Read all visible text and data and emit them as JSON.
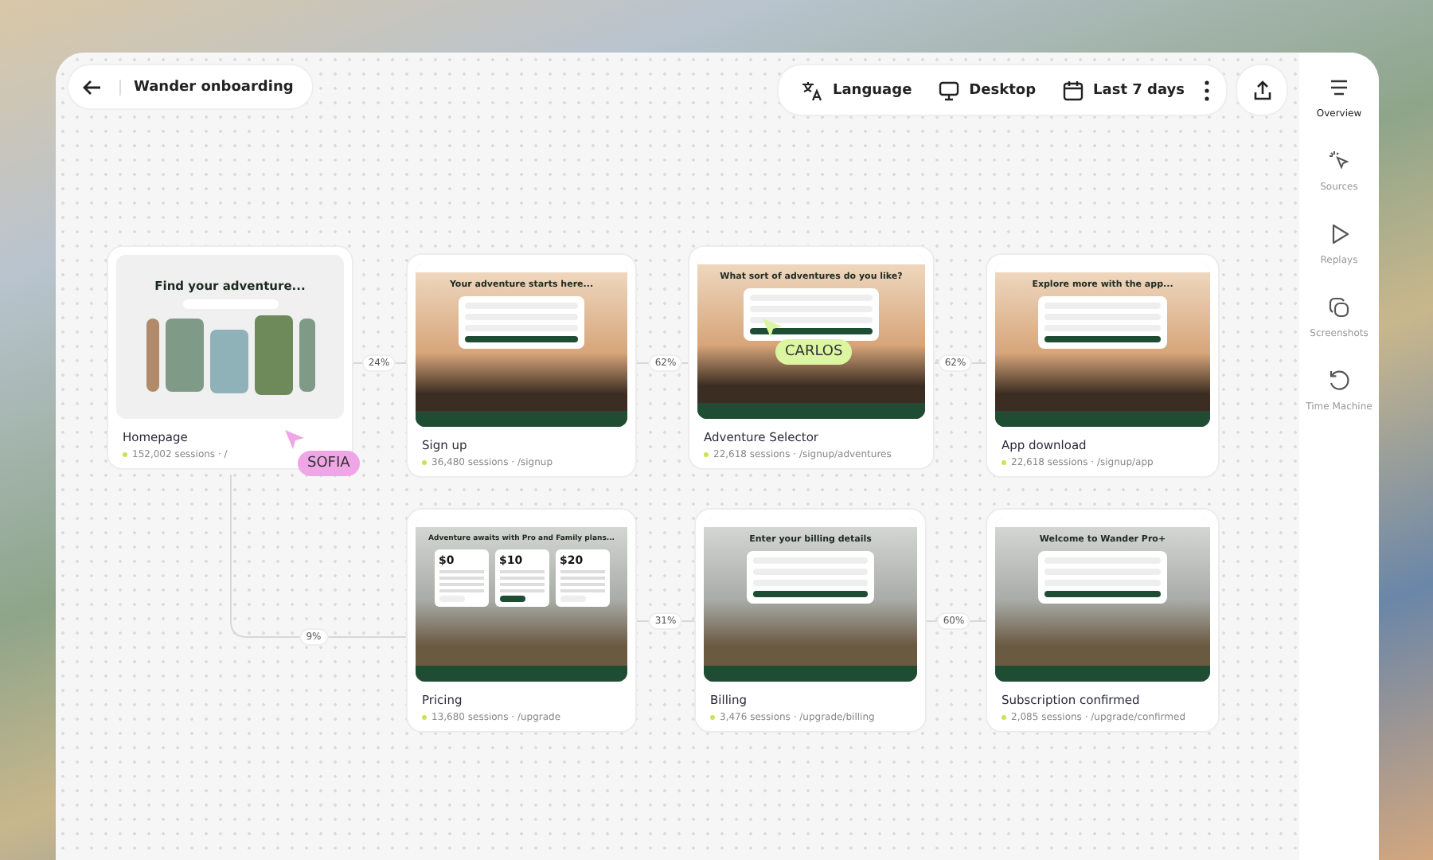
{
  "toolbar": {
    "title": "Wander onboarding",
    "filters": [
      {
        "kind": "language",
        "label": "Language"
      },
      {
        "kind": "device",
        "label": "Desktop"
      },
      {
        "kind": "date",
        "label": "Last 7 days"
      }
    ]
  },
  "sidebar": {
    "items": [
      {
        "kind": "overview",
        "label": "Overview",
        "selected": true
      },
      {
        "kind": "sources",
        "label": "Sources",
        "selected": false
      },
      {
        "kind": "replays",
        "label": "Replays",
        "selected": false
      },
      {
        "kind": "screenshots",
        "label": "Screenshots",
        "selected": false
      },
      {
        "kind": "time",
        "label": "Time Machine",
        "selected": false
      }
    ]
  },
  "steps": [
    {
      "title": "Homepage",
      "stats": "152,002 sessions · /",
      "thumbnail": {
        "kind": "gallery",
        "headline": "Find your adventure..."
      }
    },
    {
      "title": "Sign up",
      "stats": "36,480 sessions · /signup",
      "thumbnail": {
        "kind": "sunset",
        "headline": "Your adventure starts here..."
      }
    },
    {
      "title": "Adventure Selector",
      "stats": "22,618 sessions · /signup/adventures",
      "thumbnail": {
        "kind": "sunset",
        "headline": "What sort of adventures do you like?"
      }
    },
    {
      "title": "App download",
      "stats": "22,618 sessions · /signup/app",
      "thumbnail": {
        "kind": "sunset",
        "headline": "Explore more with the app..."
      }
    },
    {
      "title": "Pricing",
      "stats": "13,680 sessions · /upgrade",
      "thumbnail": {
        "kind": "pricing",
        "headline": "Adventure awaits with Pro and Family plans...",
        "prices": [
          "$0",
          "$10",
          "$20"
        ]
      }
    },
    {
      "title": "Billing",
      "stats": "3,476 sessions · /upgrade/billing",
      "thumbnail": {
        "kind": "desert",
        "headline": "Enter your billing details"
      }
    },
    {
      "title": "Subscription confirmed",
      "stats": "2,085 sessions · /upgrade/confirmed",
      "thumbnail": {
        "kind": "desert",
        "headline": "Welcome to Wander Pro+"
      }
    }
  ],
  "conversions": [
    "24%",
    "62%",
    "62%",
    "9%",
    "31%",
    "60%"
  ],
  "cursors": [
    {
      "name": "SOFIA",
      "color": "#f0a6e6"
    },
    {
      "name": "CARLOS",
      "color": "#dcf5a0"
    }
  ]
}
